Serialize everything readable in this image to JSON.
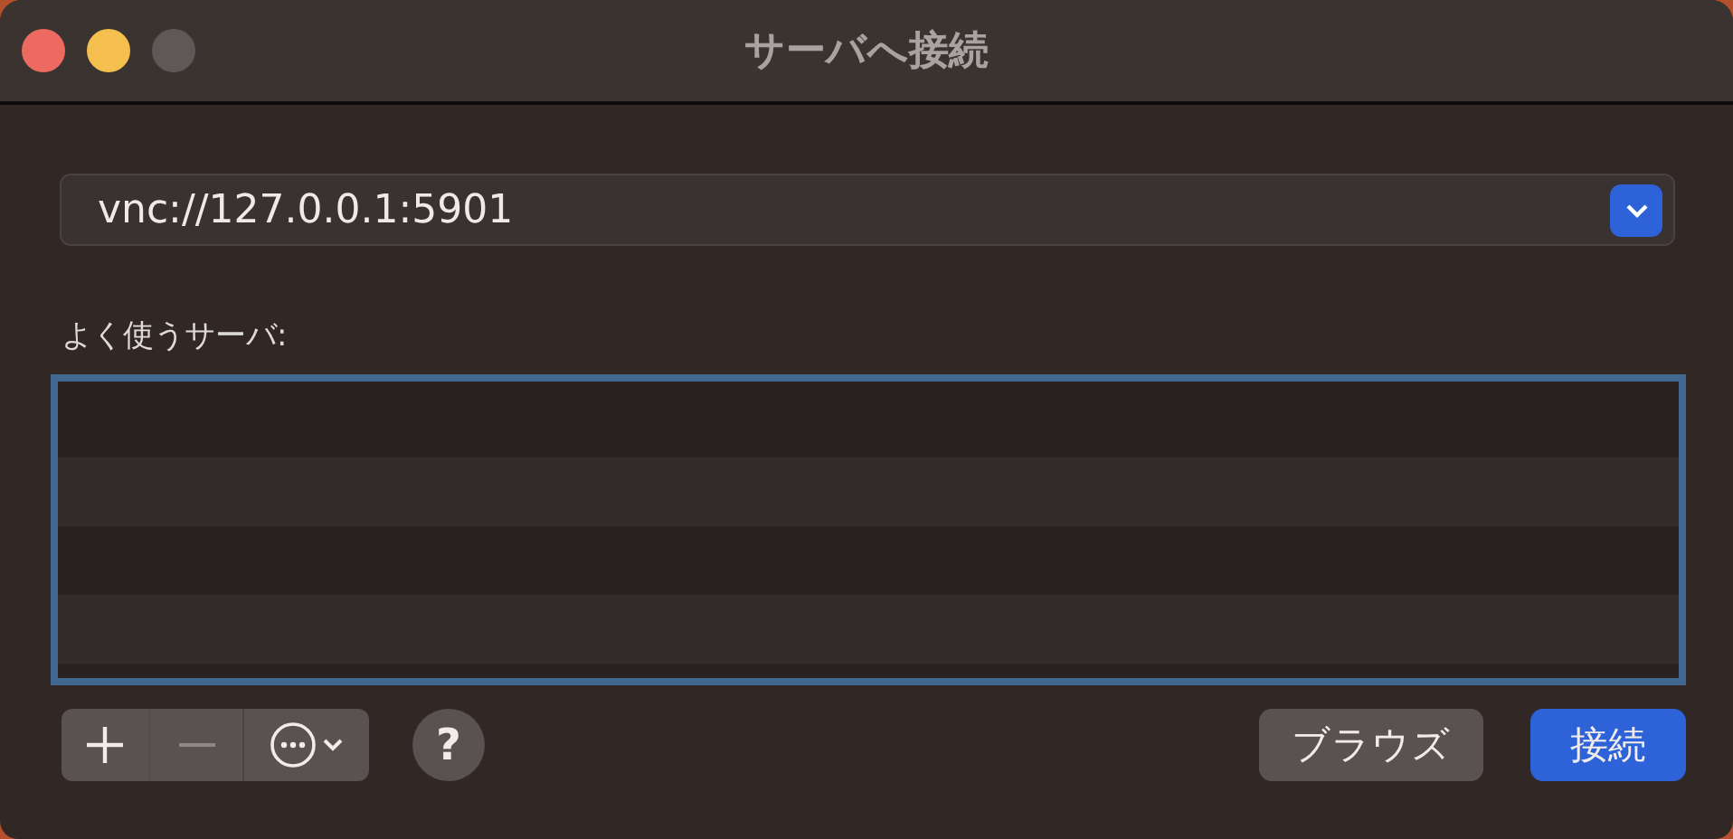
{
  "window": {
    "title": "サーバへ接続"
  },
  "server_address": {
    "value": "vnc://127.0.0.1:5901"
  },
  "favorites": {
    "label": "よく使うサーバ:",
    "focused": true
  },
  "list_controls": [
    {
      "kind": "add",
      "disabled": false
    },
    {
      "kind": "remove",
      "disabled": true
    },
    {
      "kind": "action",
      "disabled": false
    }
  ],
  "help": {
    "label": "?"
  },
  "buttons": [
    {
      "label": "ブラウズ",
      "primary": false
    },
    {
      "label": "接続",
      "primary": true
    }
  ]
}
